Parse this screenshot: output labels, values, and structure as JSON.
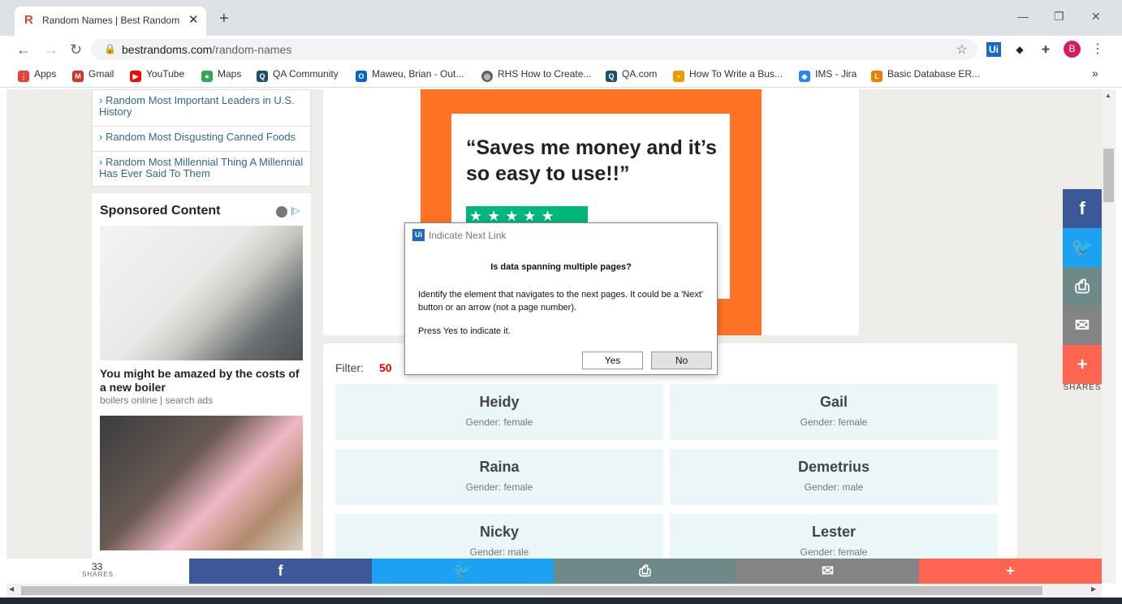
{
  "browser": {
    "tab_title": "Random Names | Best Random T",
    "tab_favicon": "R",
    "url_domain": "bestrandoms.com",
    "url_path": "/random-names",
    "profile_initial": "B",
    "ext_ui": "Ui"
  },
  "bookmarks": [
    {
      "label": "Apps",
      "icon": "apps-grid-icon",
      "color": "#e94235"
    },
    {
      "label": "Gmail",
      "icon": "gmail-icon",
      "color": "#d93025"
    },
    {
      "label": "YouTube",
      "icon": "youtube-icon",
      "color": "#ff0000"
    },
    {
      "label": "Maps",
      "icon": "maps-pin-icon",
      "color": "#34a853"
    },
    {
      "label": "QA Community",
      "icon": "qa-icon",
      "color": "#1b4f72"
    },
    {
      "label": "Maweu, Brian - Out...",
      "icon": "outlook-icon",
      "color": "#0a64c8"
    },
    {
      "label": "RHS How to Create...",
      "icon": "globe-icon",
      "color": "#5f6368"
    },
    {
      "label": "QA.com",
      "icon": "qa-icon",
      "color": "#1b4f72"
    },
    {
      "label": "How To Write a Bus...",
      "icon": "dots-icon",
      "color": "#f29900"
    },
    {
      "label": "IMS - Jira",
      "icon": "jira-icon",
      "color": "#2684ff"
    },
    {
      "label": "Basic Database ER...",
      "icon": "lucid-icon",
      "color": "#f57c00"
    }
  ],
  "sidebar": {
    "links": [
      "› Random Most Important Leaders in U.S. History",
      "› Random Most Disgusting Canned Foods",
      "› Random Most Millennial Thing A Millennial Has Ever Said To Them"
    ],
    "sponsored_title": "Sponsored Content",
    "ad_headline": "You might be amazed by the costs of a new boiler",
    "ad_source": "boilers online | search ads"
  },
  "main_ad": {
    "quote": "“Saves me money and it’s so easy to use!!”",
    "stars": "★★★★★"
  },
  "results": {
    "filter_label": "Filter:",
    "filter_value": "50",
    "names": [
      {
        "name": "Heidy",
        "gender": "Gender: female"
      },
      {
        "name": "Gail",
        "gender": "Gender: female"
      },
      {
        "name": "Raina",
        "gender": "Gender: female"
      },
      {
        "name": "Demetrius",
        "gender": "Gender: male"
      },
      {
        "name": "Nicky",
        "gender": "Gender: male"
      },
      {
        "name": "Lester",
        "gender": "Gender: female"
      }
    ]
  },
  "share": {
    "count": "33",
    "count_label": "SHARES",
    "side_label": "SHARES",
    "facebook_color": "#3b5998",
    "twitter_color": "#1da1f2",
    "print_color": "#6d8a89",
    "email_color": "#848484",
    "more_color": "#ff6550"
  },
  "dialog": {
    "icon": "Ui",
    "title": "Indicate Next Link",
    "question": "Is data spanning multiple pages?",
    "body": "Identify the element that navigates to the next pages. It could be a 'Next' button or an arrow (not a page number).",
    "press": "Press Yes to indicate it.",
    "yes": "Yes",
    "no": "No"
  }
}
